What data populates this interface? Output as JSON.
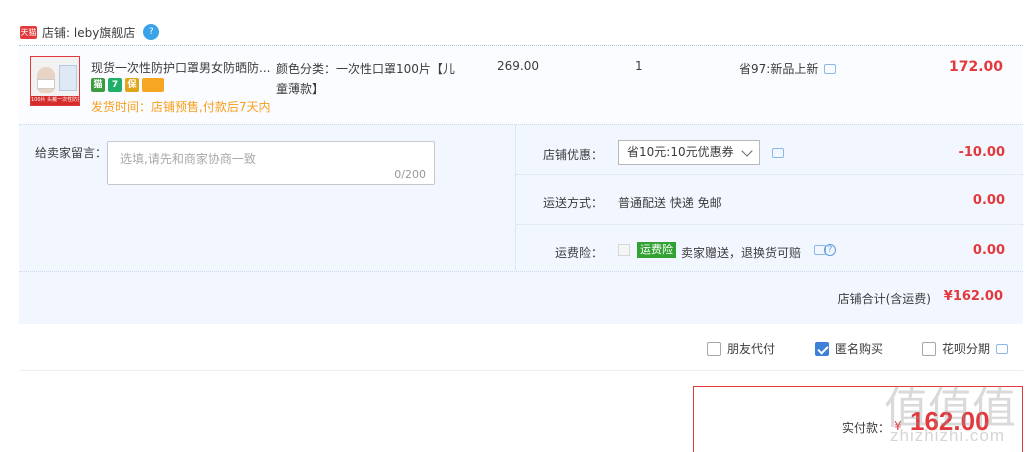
{
  "store": {
    "badge": "天猫",
    "name": "店铺: leby旗舰店"
  },
  "item": {
    "thumb_banner": "100片 头戴一次性防护口罩",
    "title": "现货一次性防护口罩男女防晒防...",
    "ship_note": "发货时间：店铺预售,付款后7天内",
    "sku": "颜色分类：一次性口罩100片【儿童薄款】",
    "unit_price": "269.00",
    "quantity": "1",
    "promo": "省97:新品上新",
    "total": "172.00"
  },
  "message": {
    "label": "给卖家留言：",
    "placeholder": "选填,请先和商家协商一致",
    "counter": "0/200"
  },
  "discount": {
    "label": "店铺优惠：",
    "selected": "省10元:10元优惠券",
    "amount": "-10.00"
  },
  "shipping": {
    "label": "运送方式：",
    "method": "普通配送 快递 免邮",
    "amount": "0.00"
  },
  "insurance": {
    "label": "运费险：",
    "tag": "运费险",
    "text": "卖家赠送，退换货可赔",
    "amount": "0.00"
  },
  "subtotal": {
    "label": "店铺合计(含运费)",
    "value": "¥162.00"
  },
  "options": {
    "friend_pay": "朋友代付",
    "anonymous": "匿名购买",
    "huabei": "花呗分期"
  },
  "payment": {
    "label": "实付款：",
    "currency": "¥",
    "value": "162.00"
  },
  "watermark": {
    "glyphs": "值值值",
    "site": "zhizhizhi.com"
  }
}
